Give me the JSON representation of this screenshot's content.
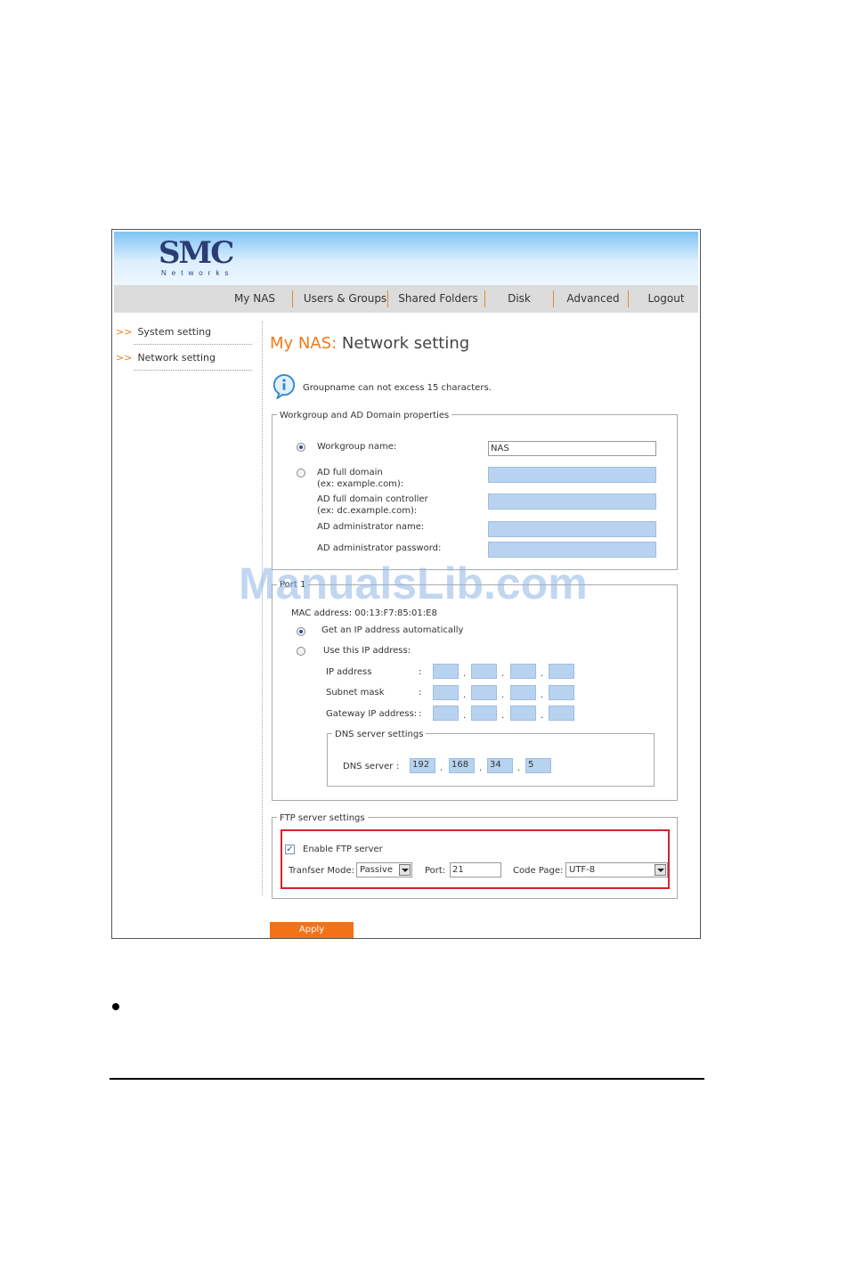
{
  "brand": {
    "logo": "SMC",
    "logo_sub": "Networks"
  },
  "nav": [
    {
      "label": "My NAS"
    },
    {
      "label": "Users & Groups"
    },
    {
      "label": "Shared Folders"
    },
    {
      "label": "Disk"
    },
    {
      "label": "Advanced"
    },
    {
      "label": "Logout"
    }
  ],
  "sidebar": {
    "arrow": ">>",
    "items": [
      {
        "label": "System setting"
      },
      {
        "label": "Network setting"
      }
    ]
  },
  "page": {
    "title_prefix": "My NAS:",
    "title": "Network setting",
    "info": "Groupname can not excess 15 characters."
  },
  "workgroup": {
    "legend": "Workgroup and AD Domain properties",
    "workgroup_label": "Workgroup name:",
    "workgroup_value": "NAS",
    "ad_domain_label": "AD full domain",
    "ad_domain_hint": "(ex: example.com):",
    "ad_controller_label": "AD full domain controller",
    "ad_controller_hint": "(ex: dc.example.com):",
    "ad_admin_label": "AD administrator name:",
    "ad_password_label": "AD administrator password:"
  },
  "port": {
    "legend": "Port 1",
    "mac": "MAC address: 00:13:F7:85:01:E8",
    "auto_label": "Get an IP address automatically",
    "manual_label": "Use this IP address:",
    "ip_label": "IP address",
    "subnet_label": "Subnet mask",
    "gateway_label": "Gateway IP address:",
    "colon": ":",
    "dot": ".",
    "dns": {
      "legend": "DNS server settings",
      "label": "DNS server",
      "octets": [
        "192",
        "168",
        "34",
        "5"
      ]
    }
  },
  "ftp": {
    "legend": "FTP server settings",
    "enable_label": "Enable FTP server",
    "check_mark": "✓",
    "mode_label": "Tranfser Mode:",
    "mode_value": "Passive",
    "port_label": "Port:",
    "port_value": "21",
    "codepage_label": "Code Page:",
    "codepage_value": "UTF-8"
  },
  "apply_label": "Apply",
  "watermark": "ManualsLib.com",
  "colors": {
    "accent": "#f47216",
    "highlight_border": "#d0262a",
    "field_blue": "#b8d3ef"
  }
}
